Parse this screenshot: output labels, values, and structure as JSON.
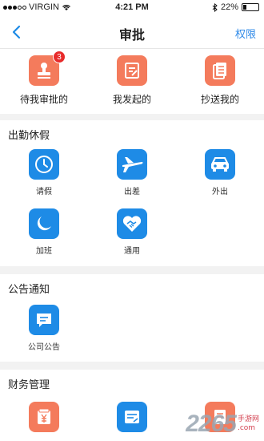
{
  "status_bar": {
    "carrier": "VIRGIN",
    "time": "4:21 PM",
    "battery": "22%",
    "battery_level": 0.22
  },
  "nav": {
    "title": "审批",
    "action": "权限"
  },
  "top_items": [
    {
      "label": "待我审批的",
      "badge": "3",
      "icon": "stamp-icon"
    },
    {
      "label": "我发起的",
      "icon": "edit-document-icon"
    },
    {
      "label": "抄送我的",
      "icon": "copy-document-icon"
    }
  ],
  "attendance": {
    "title": "出勤休假",
    "items": [
      {
        "label": "请假",
        "icon": "clock-icon"
      },
      {
        "label": "出差",
        "icon": "airplane-icon"
      },
      {
        "label": "外出",
        "icon": "car-icon"
      },
      {
        "label": "加班",
        "icon": "moon-icon"
      },
      {
        "label": "通用",
        "icon": "handshake-icon"
      }
    ]
  },
  "notice": {
    "title": "公告通知",
    "items": [
      {
        "label": "公司公告",
        "icon": "message-icon"
      }
    ]
  },
  "finance": {
    "title": "财务管理",
    "items": [
      {
        "icon": "yuan-icon"
      },
      {
        "icon": "document-icon"
      },
      {
        "icon": "invoice-icon"
      }
    ]
  },
  "watermark": {
    "text": "2265",
    "sub_line1": "手游网",
    "sub_line2": ".com"
  },
  "colors": {
    "accent": "#1e8be6",
    "orange": "#f47b5c",
    "badge": "#e82b2b"
  }
}
